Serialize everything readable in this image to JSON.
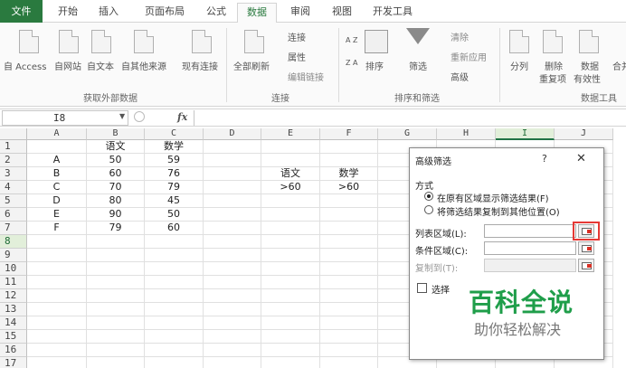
{
  "tabs": [
    "文件",
    "开始",
    "插入",
    "页面布局",
    "公式",
    "数据",
    "审阅",
    "视图",
    "开发工具"
  ],
  "ribbon": {
    "from_access": "自 Access",
    "from_web": "自网站",
    "from_text": "自文本",
    "from_other": "自其他来源",
    "existing_conn": "现有连接",
    "refresh_all": "全部刷新",
    "connections": "连接",
    "properties": "属性",
    "edit_links": "编辑链接",
    "sort": "排序",
    "filter": "筛选",
    "clear": "清除",
    "reapply": "重新应用",
    "advanced": "高级",
    "text_to_columns": "分列",
    "remove_dup_1": "删除",
    "remove_dup_2": "重复项",
    "data_valid_1": "数据",
    "data_valid_2": "有效性",
    "consolidate": "合并",
    "group_external": "获取外部数据",
    "group_connections": "连接",
    "group_sort_filter": "排序和筛选",
    "group_data_tools": "数据工具",
    "sort_az": "A Z",
    "sort_za": "Z A"
  },
  "formula_bar": {
    "name_box": "I8",
    "fx": "fx",
    "formula": ""
  },
  "columns": [
    "A",
    "B",
    "C",
    "D",
    "E",
    "F",
    "G",
    "H",
    "I",
    "J"
  ],
  "selected_column": "I",
  "selected_row": 8,
  "rows": [
    [
      "",
      "语文",
      "数学",
      "",
      "",
      "",
      "",
      "",
      "",
      ""
    ],
    [
      "A",
      "50",
      "59",
      "",
      "",
      "",
      "",
      "",
      "",
      ""
    ],
    [
      "B",
      "60",
      "76",
      "",
      "语文",
      "数学",
      "",
      "",
      "",
      ""
    ],
    [
      "C",
      "70",
      "79",
      "",
      ">60",
      ">60",
      "",
      "",
      "",
      ""
    ],
    [
      "D",
      "80",
      "45",
      "",
      "",
      "",
      "",
      "",
      "",
      ""
    ],
    [
      "E",
      "90",
      "50",
      "",
      "",
      "",
      "",
      "",
      "",
      ""
    ],
    [
      "F",
      "79",
      "60",
      "",
      "",
      "",
      "",
      "",
      "",
      ""
    ],
    [
      "",
      "",
      "",
      "",
      "",
      "",
      "",
      "",
      "",
      ""
    ],
    [
      "",
      "",
      "",
      "",
      "",
      "",
      "",
      "",
      "",
      ""
    ],
    [
      "",
      "",
      "",
      "",
      "",
      "",
      "",
      "",
      "",
      ""
    ],
    [
      "",
      "",
      "",
      "",
      "",
      "",
      "",
      "",
      "",
      ""
    ],
    [
      "",
      "",
      "",
      "",
      "",
      "",
      "",
      "",
      "",
      ""
    ],
    [
      "",
      "",
      "",
      "",
      "",
      "",
      "",
      "",
      "",
      ""
    ],
    [
      "",
      "",
      "",
      "",
      "",
      "",
      "",
      "",
      "",
      ""
    ],
    [
      "",
      "",
      "",
      "",
      "",
      "",
      "",
      "",
      "",
      ""
    ],
    [
      "",
      "",
      "",
      "",
      "",
      "",
      "",
      "",
      "",
      ""
    ],
    [
      "",
      "",
      "",
      "",
      "",
      "",
      "",
      "",
      "",
      ""
    ]
  ],
  "dialog": {
    "title": "高级筛选",
    "help": "?",
    "close": "✕",
    "mode_label": "方式",
    "option_in_place": "在原有区域显示筛选结果(F)",
    "option_copy": "将筛选结果复制到其他位置(O)",
    "list_range": "列表区域(L):",
    "criteria_range": "条件区域(C):",
    "copy_to": "复制到(T):",
    "unique_prefix": "选择"
  },
  "watermark": {
    "title": "百科全说",
    "subtitle": "助你轻松解决"
  },
  "colors": {
    "accent": "#217346",
    "file_tab": "#2a7a3f",
    "highlight": "#e53935",
    "watermark": "#1f9e4a"
  }
}
